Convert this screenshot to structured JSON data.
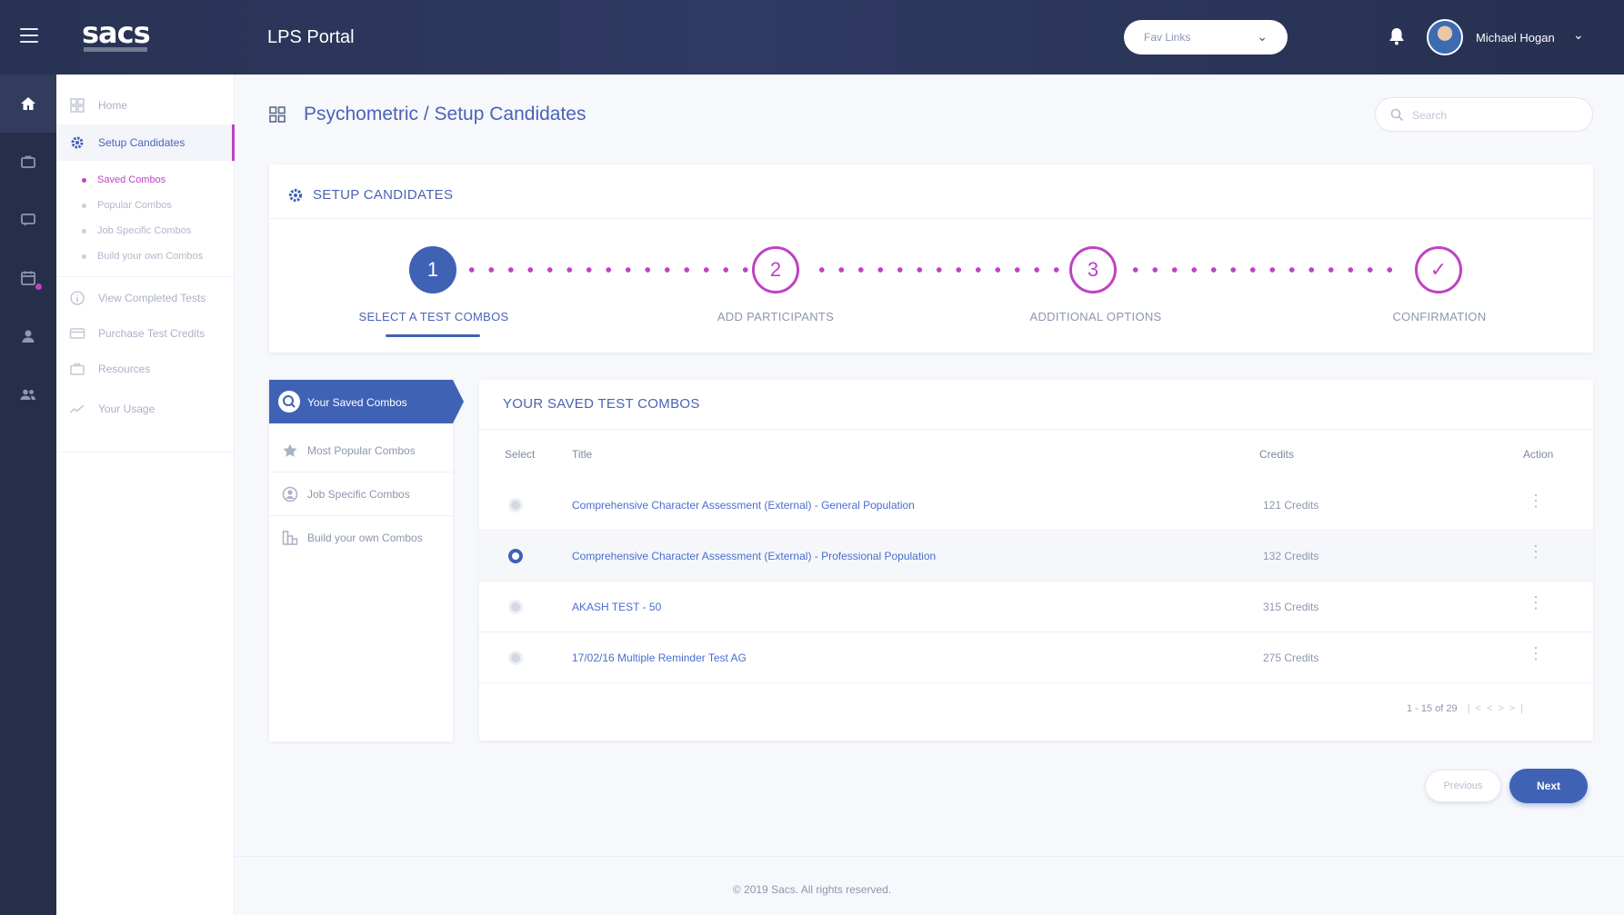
{
  "header": {
    "logo": "sacs",
    "portal_title": "LPS Portal",
    "fav_links": "Fav Links",
    "user_name": "Michael Hogan"
  },
  "sidebar": {
    "items": [
      {
        "label": "Home",
        "icon": "dashboard-icon"
      },
      {
        "label": "Setup Candidates",
        "icon": "gear-icon"
      },
      {
        "label": "View Completed Tests",
        "icon": "info-icon"
      },
      {
        "label": "Purchase Test Credits",
        "icon": "card-icon"
      },
      {
        "label": "Resources",
        "icon": "briefcase-icon"
      },
      {
        "label": "Your Usage",
        "icon": "chart-line-icon"
      }
    ],
    "sub_items": [
      "Saved Combos",
      "Popular Combos",
      "Job Specific Combos",
      "Build your own Combos"
    ]
  },
  "breadcrumb": "Psychometric / Setup Candidates",
  "search": {
    "placeholder": "Search"
  },
  "setup": {
    "title": "SETUP CANDIDATES",
    "steps": [
      {
        "number": "1",
        "label": "SELECT A TEST COMBOS"
      },
      {
        "number": "2",
        "label": "ADD PARTICIPANTS"
      },
      {
        "number": "3",
        "label": "ADDITIONAL OPTIONS"
      },
      {
        "number": "✓",
        "label": "CONFIRMATION"
      }
    ]
  },
  "combo_menu": [
    "Your Saved Combos",
    "Most Popular Combos",
    "Job Specific Combos",
    "Build your own Combos"
  ],
  "table": {
    "title": "YOUR SAVED TEST COMBOS",
    "columns": [
      "Select",
      "Title",
      "Credits",
      "Action"
    ],
    "rows": [
      {
        "title": "Comprehensive Character Assessment (External) - General Population",
        "credits": "121 Credits",
        "selected": false
      },
      {
        "title": "Comprehensive Character Assessment (External) - Professional Population",
        "credits": "132 Credits",
        "selected": true
      },
      {
        "title": "AKASH TEST - 50",
        "credits": "315 Credits",
        "selected": false
      },
      {
        "title": "17/02/16 Multiple Reminder Test AG",
        "credits": "275 Credits",
        "selected": false
      }
    ],
    "pagination": "1 - 15 of 29",
    "action_glyph": "⋮"
  },
  "buttons": {
    "previous": "Previous",
    "next": "Next"
  },
  "footer": "© 2019 Sacs. All rights reserved.",
  "colors": {
    "primary": "#3f62b4",
    "accent": "#c042c2",
    "topbar": "#2a3356"
  }
}
